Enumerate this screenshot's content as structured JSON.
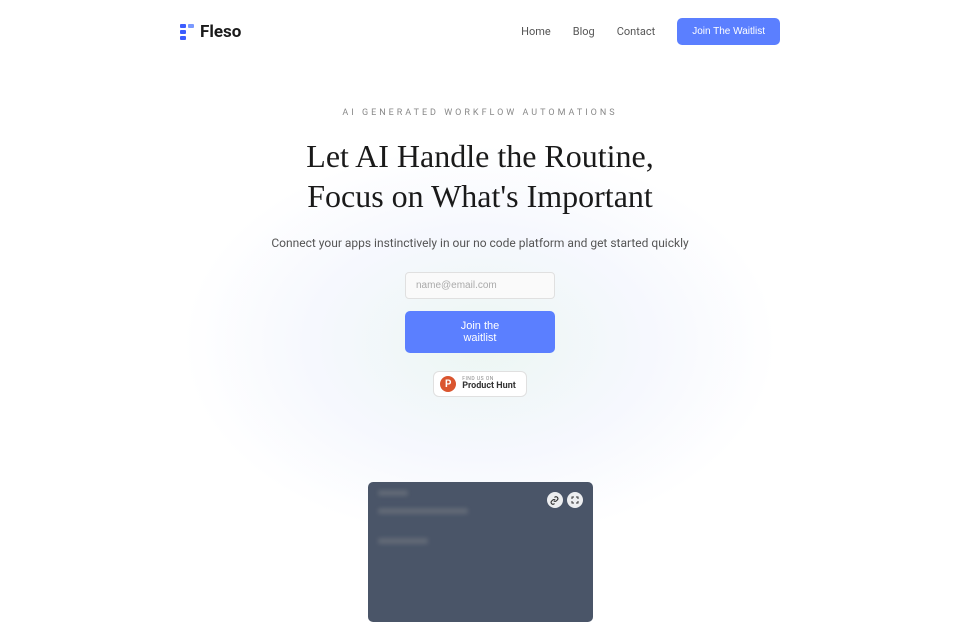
{
  "header": {
    "brand": "Fleso",
    "nav": {
      "home": "Home",
      "blog": "Blog",
      "contact": "Contact"
    },
    "waitlist_cta": "Join The Waitlist"
  },
  "hero": {
    "eyebrow": "AI GENERATED WORKFLOW AUTOMATIONS",
    "title_line1": "Let AI Handle the Routine,",
    "title_line2": "Focus on What's Important",
    "subtitle": "Connect your apps instinctively in our no code platform and get started quickly",
    "email_placeholder": "name@email.com",
    "join_cta": "Join the waitlist",
    "product_hunt": {
      "find_us": "FIND US ON",
      "name": "Product Hunt",
      "icon_letter": "P"
    }
  }
}
